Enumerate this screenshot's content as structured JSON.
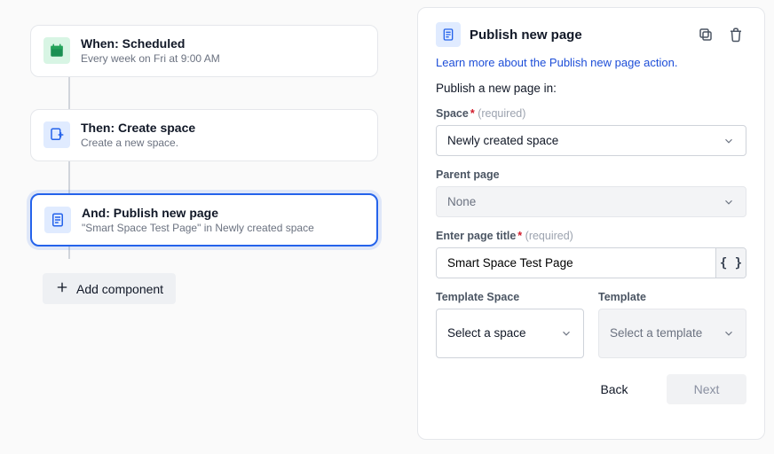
{
  "flow": {
    "when": {
      "title": "When: Scheduled",
      "subtitle": "Every week on Fri at 9:00 AM"
    },
    "then": {
      "title": "Then: Create space",
      "subtitle": "Create a new space."
    },
    "and": {
      "title": "And: Publish new page",
      "subtitle": "\"Smart Space Test Page\" in Newly created space"
    },
    "add_component": "Add component"
  },
  "panel": {
    "title": "Publish new page",
    "learn_link": "Learn more about the Publish new page action.",
    "intro": "Publish a new page in:",
    "space": {
      "label": "Space",
      "required": "(required)",
      "value": "Newly created space"
    },
    "parent": {
      "label": "Parent page",
      "value": "None"
    },
    "page_title": {
      "label": "Enter page title",
      "required": "(required)",
      "value": "Smart Space Test Page"
    },
    "template_space": {
      "label": "Template Space",
      "value": "Select a space"
    },
    "template": {
      "label": "Template",
      "value": "Select a template"
    },
    "footer": {
      "back": "Back",
      "next": "Next"
    },
    "brace": "{ }"
  }
}
